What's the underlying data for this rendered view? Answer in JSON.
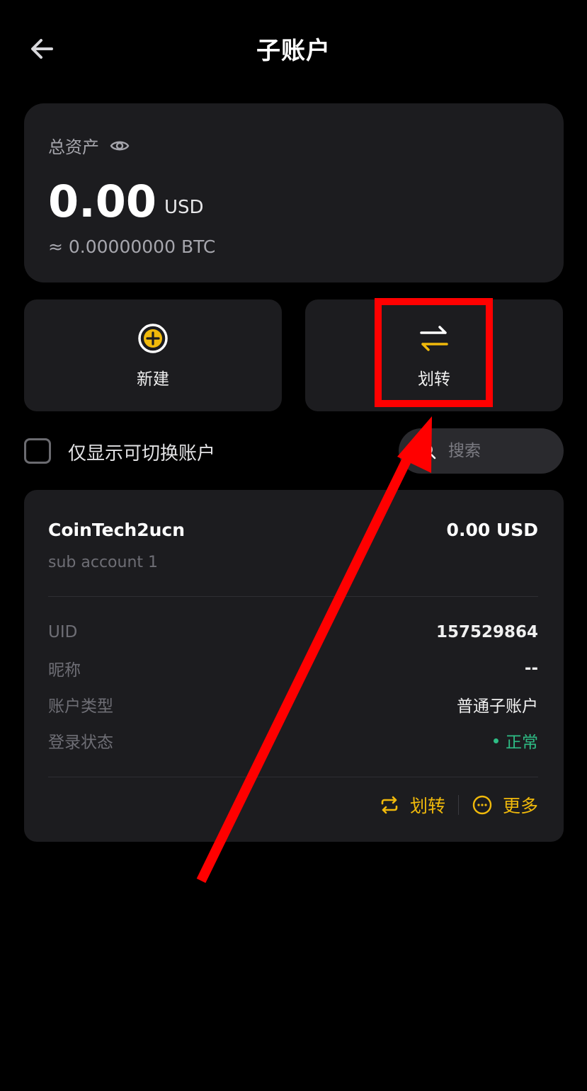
{
  "header": {
    "title": "子账户"
  },
  "assets": {
    "label": "总资产",
    "value": "0.00",
    "unit": "USD",
    "btc_equiv": "≈ 0.00000000 BTC"
  },
  "actions": {
    "new_label": "新建",
    "transfer_label": "划转"
  },
  "filter": {
    "switchable_only_label": "仅显示可切换账户",
    "search_placeholder": "搜索"
  },
  "account": {
    "name": "CoinTech2ucn",
    "balance": "0.00 USD",
    "description": "sub account 1",
    "details": [
      {
        "label": "UID",
        "value": "157529864"
      },
      {
        "label": "昵称",
        "value": "--"
      },
      {
        "label": "账户类型",
        "value": "普通子账户"
      },
      {
        "label": "登录状态",
        "value": "正常"
      }
    ],
    "transfer_label": "划转",
    "more_label": "更多"
  },
  "colors": {
    "accent": "#f0b90b",
    "status_ok": "#2ebd85",
    "annotation": "#ff0000",
    "card_bg": "#1c1c1f"
  }
}
